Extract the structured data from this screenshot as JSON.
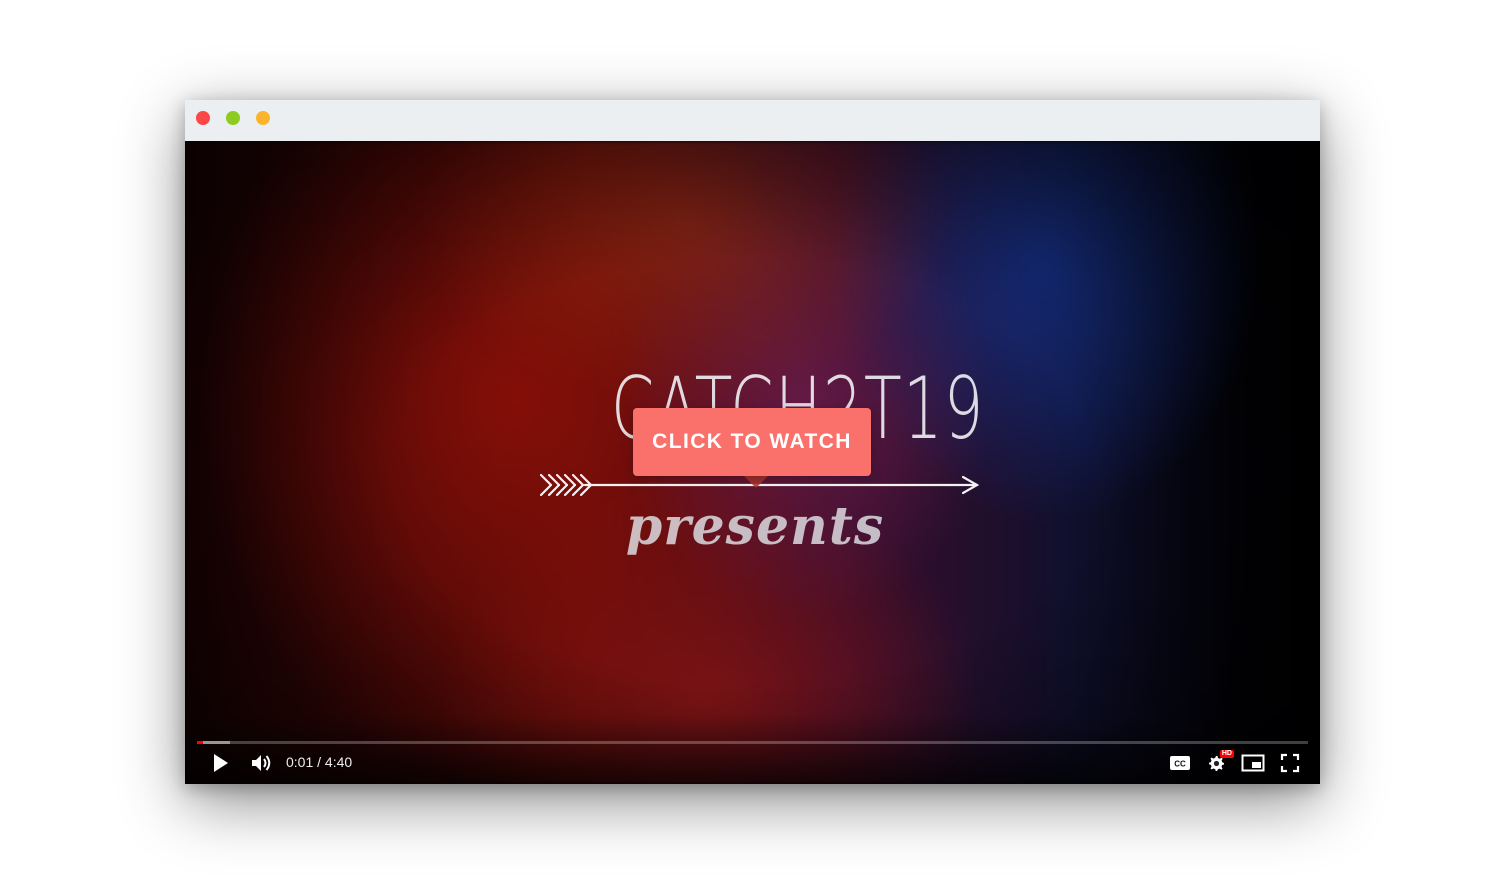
{
  "window": {
    "controls": [
      "close",
      "minimize",
      "maximize"
    ]
  },
  "video": {
    "title_text": "CATCH2T19",
    "subtitle_text": "presents",
    "cta_label": "CLICK TO WATCH",
    "cta_color": "#fa706a"
  },
  "player": {
    "current_time": "0:01",
    "separator": "/",
    "duration": "4:40",
    "progress_played_fraction": 0.005,
    "progress_buffered_fraction": 0.03,
    "hd_badge": "HD",
    "progress_color": "#ff0000",
    "icons": {
      "play": "play-icon",
      "volume": "volume-icon",
      "captions": "captions-icon",
      "settings": "settings-gear-icon",
      "miniplayer": "miniplayer-icon",
      "fullscreen": "fullscreen-icon"
    }
  }
}
